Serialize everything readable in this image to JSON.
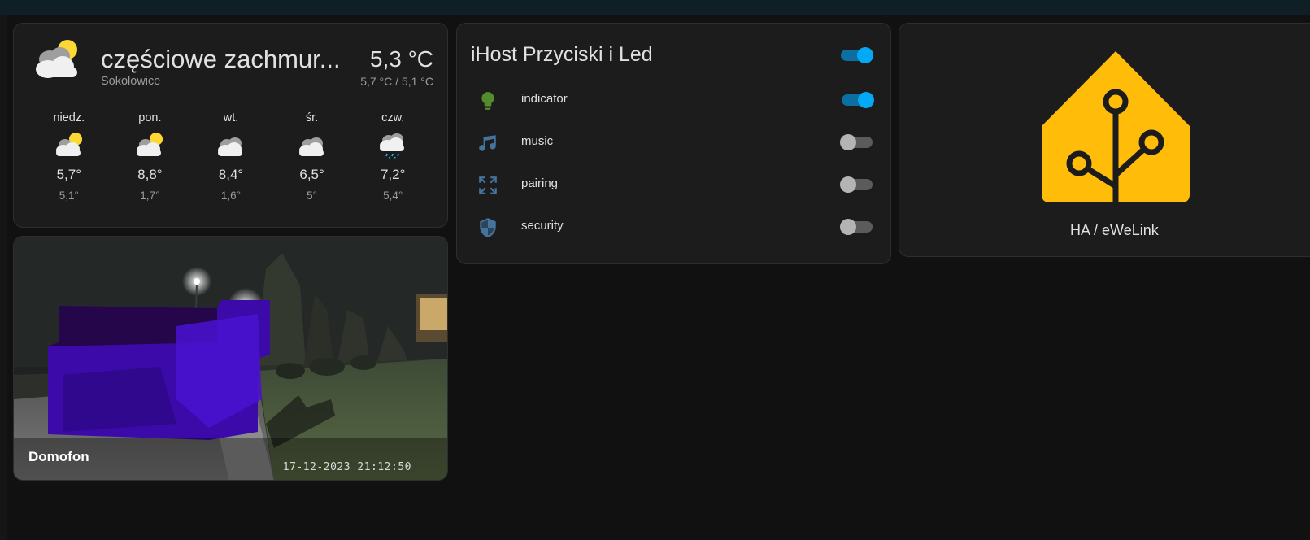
{
  "weather": {
    "condition": "częściowe zachmur...",
    "location": "Sokolowice",
    "temperature": "5,3 °C",
    "range": "5,7 °C / 5,1 °C",
    "icon": "partly-cloudy-icon",
    "forecast": [
      {
        "day": "niedz.",
        "high": "5,7°",
        "low": "5,1°",
        "icon": "partly-cloudy-icon"
      },
      {
        "day": "pon.",
        "high": "8,8°",
        "low": "1,7°",
        "icon": "partly-cloudy-icon"
      },
      {
        "day": "wt.",
        "high": "8,4°",
        "low": "1,6°",
        "icon": "cloudy-icon"
      },
      {
        "day": "śr.",
        "high": "6,5°",
        "low": "5°",
        "icon": "cloudy-icon"
      },
      {
        "day": "czw.",
        "high": "7,2°",
        "low": "5,4°",
        "icon": "rainy-icon"
      }
    ]
  },
  "camera": {
    "name": "Domofon",
    "timestamp": "17-12-2023 21:12:50"
  },
  "ihost": {
    "title": "iHost Przyciski i Led",
    "master_on": true,
    "entities": [
      {
        "label": "indicator",
        "icon": "lightbulb-icon",
        "on": true
      },
      {
        "label": "music",
        "icon": "music-note-icon",
        "on": false
      },
      {
        "label": "pairing",
        "icon": "pairing-arrows-icon",
        "on": false
      },
      {
        "label": "security",
        "icon": "shield-icon",
        "on": false
      }
    ]
  },
  "ha_card": {
    "name": "HA / eWeLink",
    "icon": "home-assistant-logo"
  },
  "colors": {
    "accent": "#03a9f4",
    "ha_yellow": "#ffbc09",
    "bulb_green": "#558b2f",
    "icon_blue": "#44739e"
  }
}
